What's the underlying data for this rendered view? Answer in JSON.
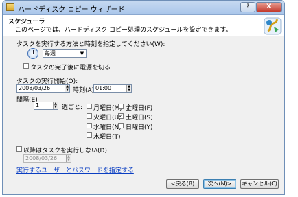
{
  "window": {
    "title": "ハードディスク コピー ウィザード",
    "help_label": "?",
    "close_label": "X"
  },
  "header": {
    "title": "スケジューラ",
    "subtitle": "このページでは、ハードディスク コピー処理のスケジュールを設定できます。"
  },
  "schedule": {
    "method_label": "タスクを実行する方法と時刻を指定してください(W):",
    "frequency_value": "毎週",
    "shutdown_label": "タスクの完了後に電源を切る",
    "shutdown_checked": false
  },
  "start": {
    "label": "タスクの実行開始(O):",
    "date_value": "2008/03/26",
    "time_label": "時刻(A)",
    "time_value": "01:00"
  },
  "interval": {
    "label": "間隔(E)",
    "value": "1",
    "unit_label": "週ごと:"
  },
  "weekdays": [
    {
      "label": "月曜日(M)",
      "checked": false
    },
    {
      "label": "金曜日(F)",
      "checked": false
    },
    {
      "label": "火曜日(U)",
      "checked": false
    },
    {
      "label": "土曜日(S)",
      "checked": true
    },
    {
      "label": "水曜日(N)",
      "checked": false
    },
    {
      "label": "日曜日(Y)",
      "checked": false
    },
    {
      "label": "木曜日(T)",
      "checked": false
    }
  ],
  "after": {
    "label": "以降はタスクを実行しない(D):",
    "checked": false,
    "date_value": "2008/03/26"
  },
  "credentials_link": "実行するユーザーとパスワードを指定する",
  "buttons": {
    "back": "<戻る(B)",
    "next": "次へ(N)>",
    "cancel": "キャンセル(C)"
  }
}
